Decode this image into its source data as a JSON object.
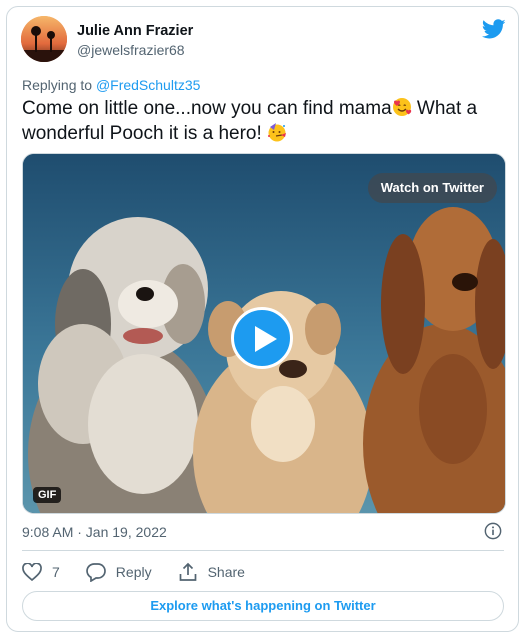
{
  "author": {
    "name": "Julie Ann Frazier",
    "handle": "@jewelsfrazier68"
  },
  "reply": {
    "prefix": "Replying to",
    "mention": "@FredSchultz35"
  },
  "tweet": {
    "line1_text": "Come on little one...now you can find mama",
    "line1_rest": " What a",
    "line2_text": "wonderful Pooch it is a hero! "
  },
  "media": {
    "watch_label": "Watch on Twitter",
    "gif_badge": "GIF"
  },
  "meta": {
    "timestamp": "9:08 AM · Jan 19, 2022"
  },
  "actions": {
    "likes": "7",
    "reply_label": "Reply",
    "share_label": "Share"
  },
  "explore_label": "Explore what's happening on Twitter",
  "colors": {
    "accent": "#1d9bf0",
    "secondary_text": "#536471",
    "border": "#cfd9de"
  },
  "icons": [
    "twitter-bird-icon",
    "play-icon",
    "info-icon",
    "heart-icon",
    "reply-icon",
    "share-icon",
    "smiling-face-with-hearts-emoji",
    "partying-face-emoji"
  ]
}
